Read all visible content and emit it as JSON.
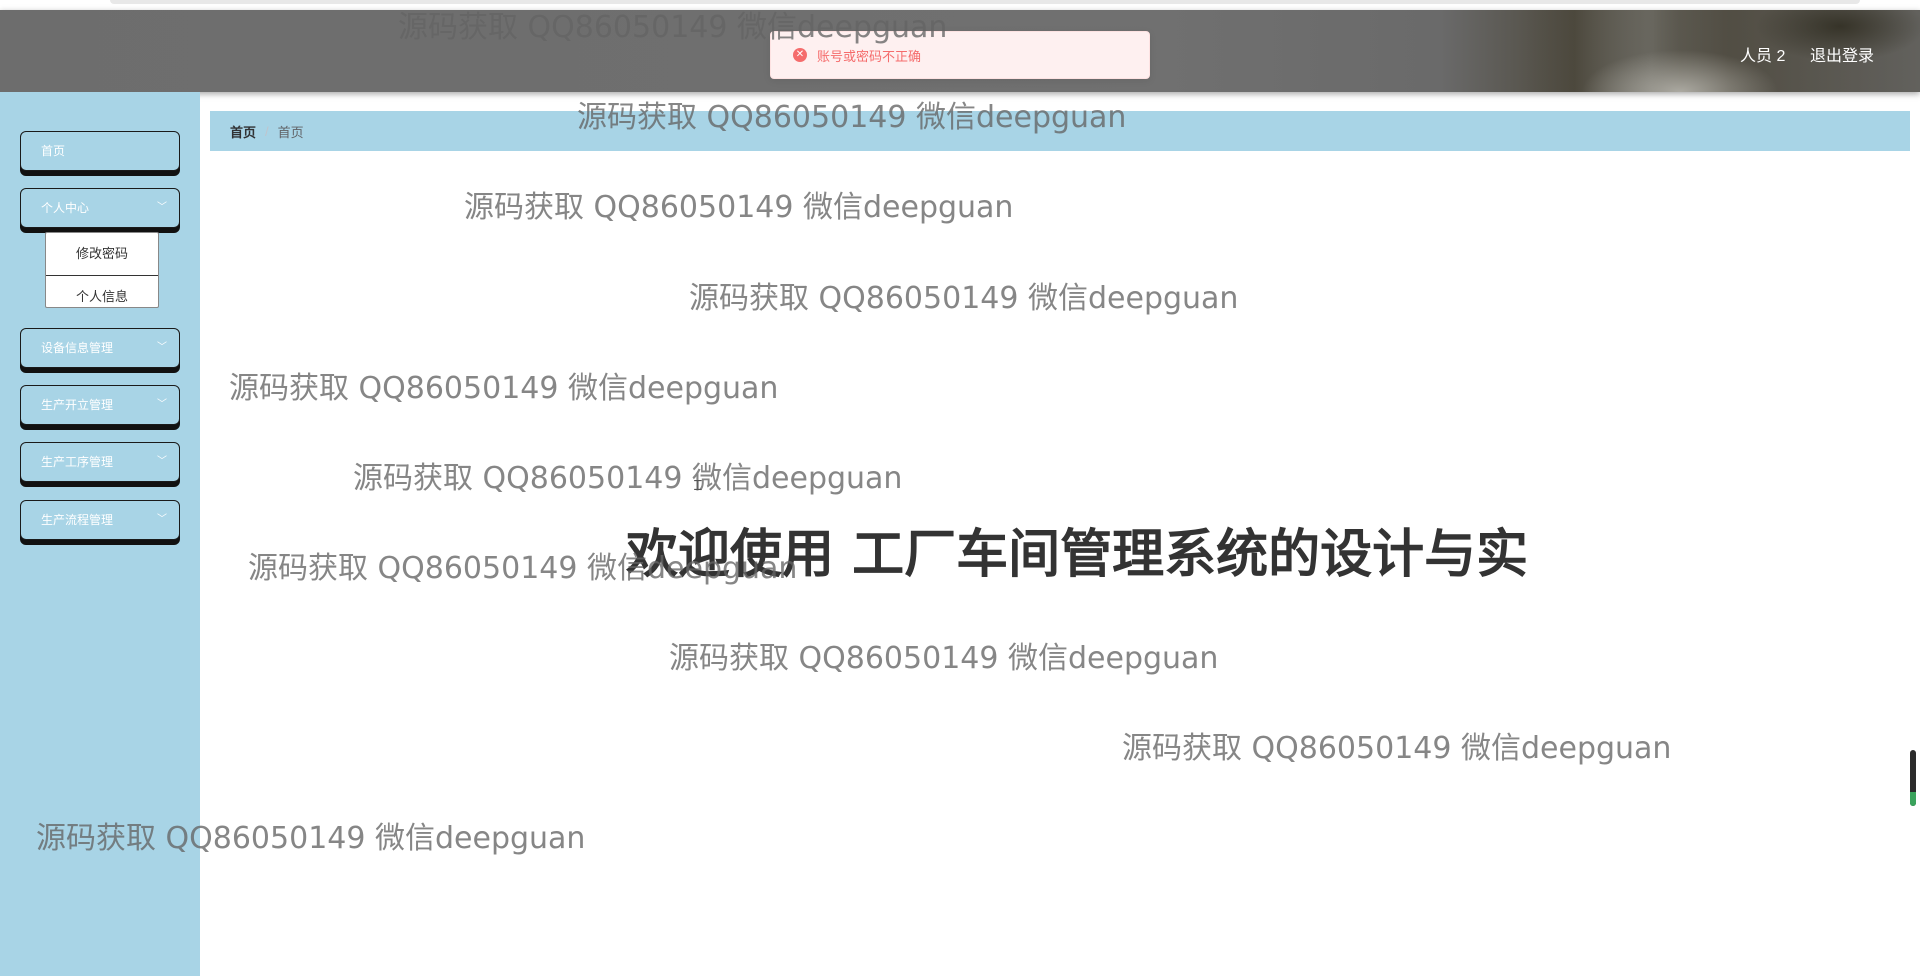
{
  "header": {
    "user_label": "人员 2",
    "logout_label": "退出登录"
  },
  "toast": {
    "icon": "error-circle-icon",
    "message": "账号或密码不正确",
    "color": "#f56c6c"
  },
  "sidebar": {
    "bg_color": "#a8d4e6",
    "items": [
      {
        "label": "首页"
      },
      {
        "label": "个人中心",
        "expanded": true
      },
      {
        "label": "设备信息管理"
      },
      {
        "label": "生产开立管理"
      },
      {
        "label": "生产工序管理"
      },
      {
        "label": "生产流程管理"
      }
    ],
    "submenu": [
      {
        "label": "修改密码"
      },
      {
        "label": "个人信息"
      }
    ]
  },
  "breadcrumb": {
    "items": [
      "首页",
      "首页"
    ],
    "separator": "/"
  },
  "main": {
    "welcome_text": "欢迎使用 工厂车间管理系统的设计与实"
  },
  "watermark": {
    "text": "源码获取 QQ86050149 微信deepguan"
  }
}
